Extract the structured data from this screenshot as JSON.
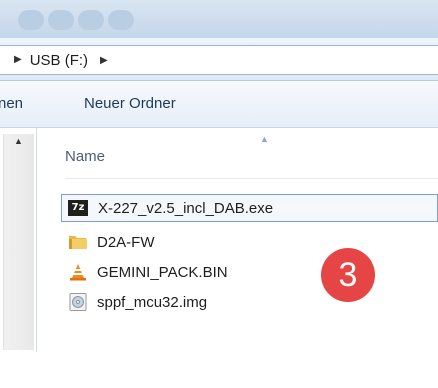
{
  "address": {
    "crumb": "USB (F:)"
  },
  "toolbar": {
    "partial_label": "nen",
    "new_folder_label": "Neuer Ordner"
  },
  "filelist": {
    "column_header": "Name",
    "files": [
      {
        "name": "X-227_v2.5_incl_DAB.exe",
        "icon": "7zip-exe-icon",
        "selected": true
      },
      {
        "name": "D2A-FW",
        "icon": "folder-icon"
      },
      {
        "name": "GEMINI_PACK.BIN",
        "icon": "vlc-cone-icon"
      },
      {
        "name": "sppf_mcu32.img",
        "icon": "disc-image-icon"
      }
    ]
  },
  "badge": {
    "label": "3",
    "color": "#e64545"
  }
}
